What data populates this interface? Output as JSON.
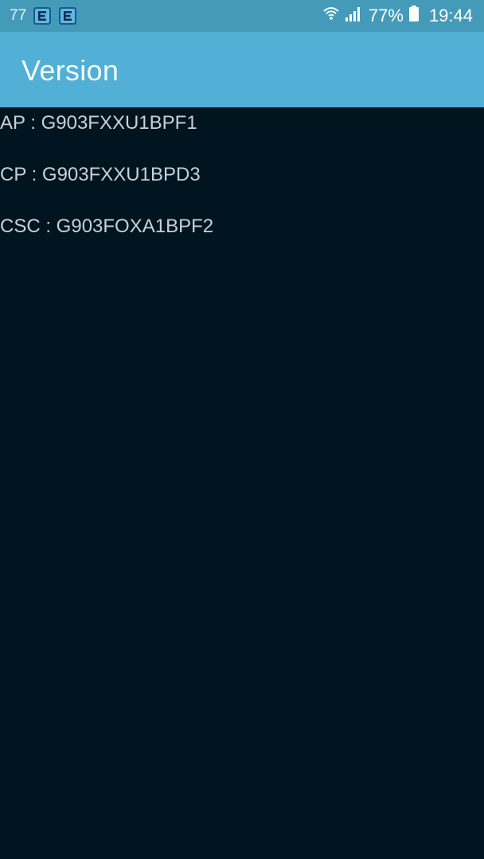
{
  "status_bar": {
    "notification_count": "77",
    "notification_icons": [
      "app-e-icon",
      "app-e-icon"
    ],
    "wifi_icon": "wifi-icon",
    "signal_icon": "cell-signal-icon",
    "battery_percent": "77%",
    "battery_icon": "battery-icon",
    "time": "19:44"
  },
  "app_bar": {
    "title": "Version"
  },
  "versions": [
    {
      "label": "AP : G903FXXU1BPF1"
    },
    {
      "label": "CP : G903FXXU1BPD3"
    },
    {
      "label": "CSC : G903FOXA1BPF2"
    }
  ],
  "colors": {
    "status_bar_bg": "#449bb9",
    "app_bar_bg": "#52afd6",
    "screen_bg": "#00151f",
    "text": "#c8d1d6"
  }
}
